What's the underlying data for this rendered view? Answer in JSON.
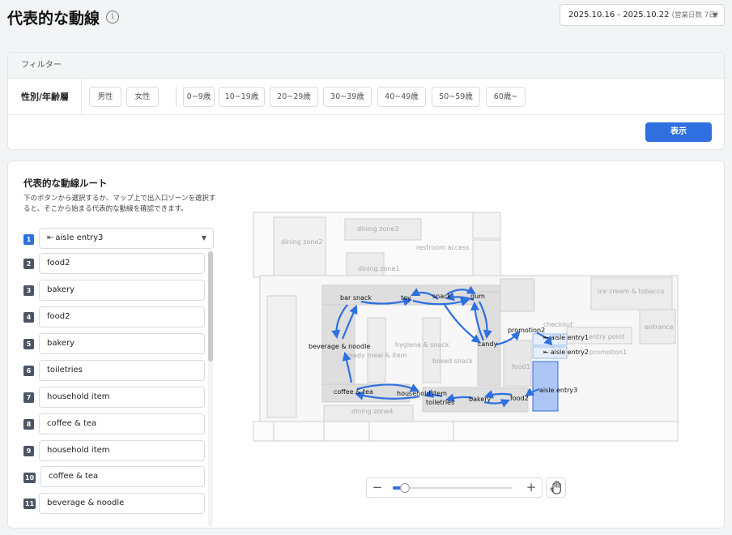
{
  "header": {
    "title": "代表的な動線",
    "info_icon": "info-icon",
    "date_range": "2025.10.16 - 2025.10.22",
    "date_note": "(営業日数 7日)"
  },
  "filter": {
    "heading": "フィルター",
    "row_label": "性別/年齢層",
    "gender_chips": [
      "男性",
      "女性"
    ],
    "age_chips": [
      "0~9歳",
      "10~19歳",
      "20~29歳",
      "30~39歳",
      "40~49歳",
      "50~59歳",
      "60歳~"
    ],
    "show_button": "表示"
  },
  "route": {
    "title": "代表的な動線ルート",
    "description": "下のボタンから選択するか、マップ上で出入口ゾーンを選択すると、そこから始まる代表的な動線を確認できます。",
    "entry_icon": "exit-icon",
    "steps": [
      {
        "num": "1",
        "label": "aisle entry3"
      },
      {
        "num": "2",
        "label": "food2"
      },
      {
        "num": "3",
        "label": "bakery"
      },
      {
        "num": "4",
        "label": "food2"
      },
      {
        "num": "5",
        "label": "bakery"
      },
      {
        "num": "6",
        "label": "toiletries"
      },
      {
        "num": "7",
        "label": "household item"
      },
      {
        "num": "8",
        "label": "coffee & tea"
      },
      {
        "num": "9",
        "label": "household item"
      },
      {
        "num": "10",
        "label": "coffee & tea"
      },
      {
        "num": "11",
        "label": "beverage & noodle"
      }
    ]
  },
  "map": {
    "zone_labels": {
      "dining_zone3": "dining zone3",
      "dining_zone2": "dining zone2",
      "restroom_access": "restroom access",
      "dining_zone1": "dining zone1",
      "ice_cream": "ice cream & tobacco",
      "checkout": "checkout",
      "entry_point": "entry point",
      "entrance": "entrance",
      "promotion1": "promotion1",
      "hygiene": "hygiene & snack",
      "ready_meal": "ready meal & item",
      "boxed_snack": "boxed snack",
      "food1": "food1",
      "dining_zone4": "dining zone4"
    },
    "route_labels": {
      "bar_snack": "bar snack",
      "toy": "toy",
      "snack": "snack",
      "gum": "gum",
      "promotion2": "promotion2",
      "aisle_entry1": "aisle entry1",
      "aisle_entry2": "aisle entry2",
      "candy": "candy",
      "beverage": "beverage & noodle",
      "coffee": "coffee & tea",
      "household": "household item",
      "toiletries": "toiletries",
      "bakery": "bakery",
      "food2": "food2",
      "aisle_entry3": "aisle entry3"
    },
    "route_color": "#2f6fe0",
    "highlight_zone": "aisle entry3"
  },
  "controls": {
    "zoom_out_icon": "minus-icon",
    "zoom_in_icon": "plus-icon",
    "zoom_level": 0.05,
    "pan_icon": "hand-icon"
  },
  "colors": {
    "accent": "#2f6fe0",
    "zone_fill": "#dedede",
    "panel_border": "#e3e5e8"
  }
}
